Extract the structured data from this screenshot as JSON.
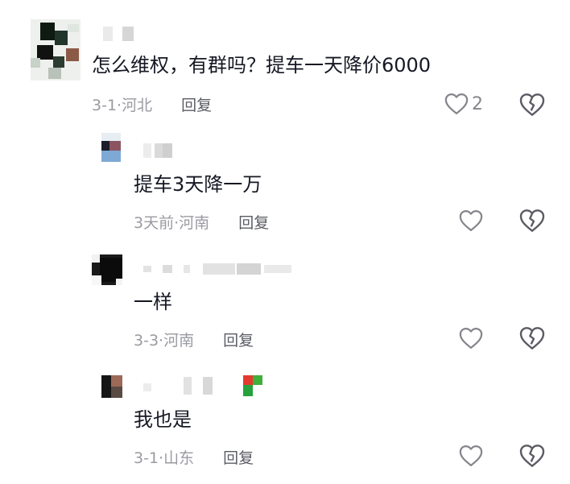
{
  "comments": [
    {
      "text": "怎么维权，有群吗？提车一天降价6000",
      "date": "3-1",
      "location": "河北",
      "separator": "·",
      "reply": "回复",
      "likes": "2",
      "icons": {
        "like": "heart-icon",
        "dislike": "broken-heart-icon"
      }
    },
    {
      "text": "提车3天降一万",
      "date": "3天前",
      "location": "河南",
      "separator": "·",
      "reply": "回复",
      "likes": "",
      "icons": {
        "like": "heart-icon",
        "dislike": "broken-heart-icon"
      }
    },
    {
      "text": "一样",
      "date": "3-3",
      "location": "河南",
      "separator": "·",
      "reply": "回复",
      "likes": "",
      "icons": {
        "like": "heart-icon",
        "dislike": "broken-heart-icon"
      }
    },
    {
      "text": "我也是",
      "date": "3-1",
      "location": "山东",
      "separator": "·",
      "reply": "回复",
      "likes": "",
      "icons": {
        "like": "heart-icon",
        "dislike": "broken-heart-icon"
      }
    }
  ]
}
